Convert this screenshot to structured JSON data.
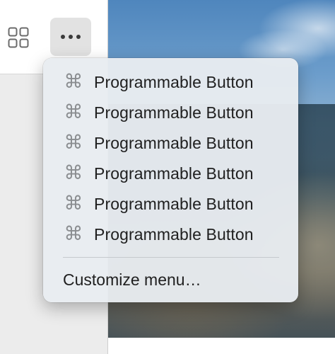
{
  "toolbar": {
    "icons": [
      "grid-icon",
      "more-icon"
    ]
  },
  "menu": {
    "items": [
      {
        "icon": "command-icon",
        "glyph": "⌘",
        "label": "Programmable Button"
      },
      {
        "icon": "command-icon",
        "glyph": "⌘",
        "label": "Programmable Button"
      },
      {
        "icon": "command-icon",
        "glyph": "⌘",
        "label": "Programmable Button"
      },
      {
        "icon": "command-icon",
        "glyph": "⌘",
        "label": "Programmable Button"
      },
      {
        "icon": "command-icon",
        "glyph": "⌘",
        "label": "Programmable Button"
      },
      {
        "icon": "command-icon",
        "glyph": "⌘",
        "label": "Programmable Button"
      }
    ],
    "customize_label": "Customize menu…"
  },
  "colors": {
    "menu_background": "#e8ecf0",
    "icon_gray": "#8a8d90",
    "text": "#1f1f1f"
  }
}
